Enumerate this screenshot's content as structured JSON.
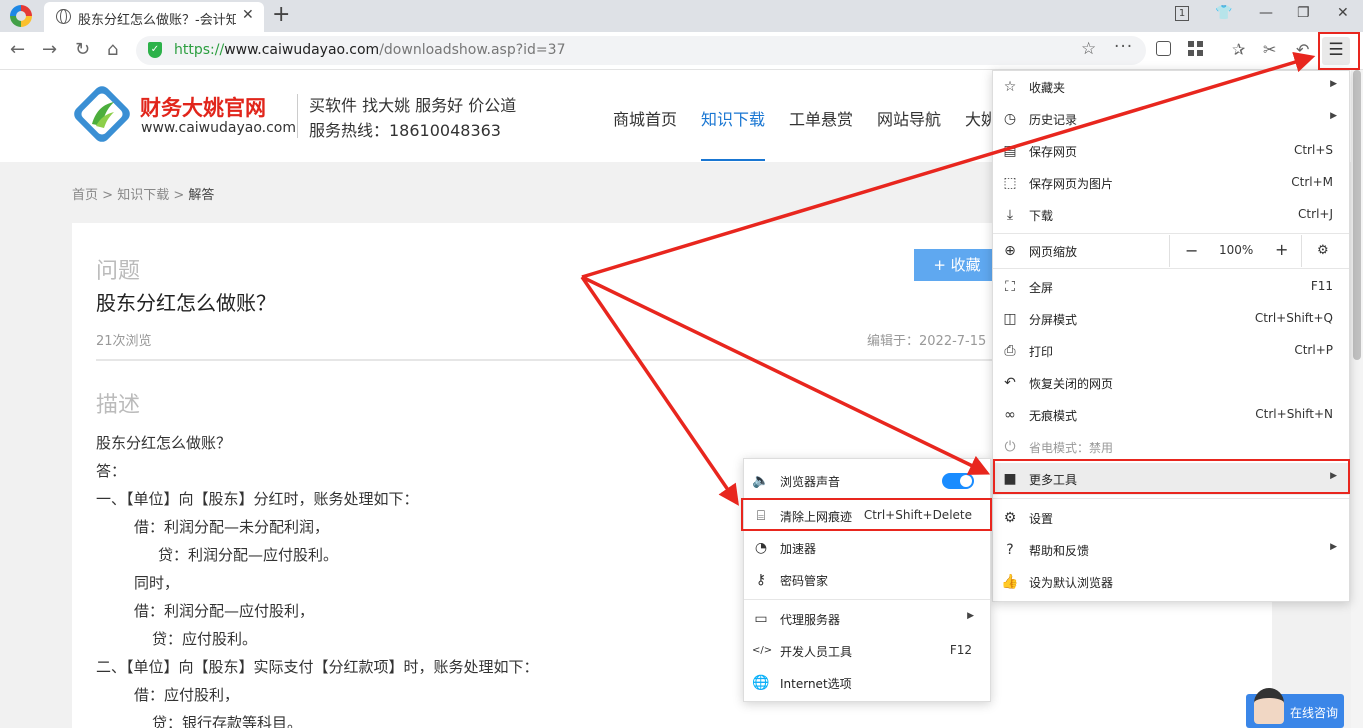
{
  "browser": {
    "tab_title": "股东分红怎么做账？-会计知识",
    "url_scheme": "https://",
    "url_host": "www.caiwudayao.com",
    "url_path": "/downloadshow.asp?id=37",
    "window_badge": "1"
  },
  "site": {
    "logo_name": "财务大姚官网",
    "logo_url": "www.caiwudayao.com",
    "slogan": "买软件  找大姚  服务好  价公道",
    "hotline": "服务热线：18610048363",
    "nav": [
      "商城首页",
      "知识下载",
      "工单悬赏",
      "网站导航",
      "大姚"
    ]
  },
  "breadcrumb": {
    "home": "首页",
    "sep": ">",
    "section": "知识下载",
    "current": "解答"
  },
  "article": {
    "question_label": "问题",
    "title": "股东分红怎么做账？",
    "favorite_label": "+ 收藏",
    "views": "21次浏览",
    "edited": "编辑于：2022-7-15",
    "desc_label": "描述",
    "lines": [
      "股东分红怎么做账？",
      "答：",
      "一、【单位】向【股东】分红时，账务处理如下：",
      "借：利润分配—未分配利润，",
      "贷：利润分配—应付股利。",
      "同时，",
      "借：利润分配—应付股利，",
      "贷：应付股利。",
      "二、【单位】向【股东】实际支付【分红款项】时，账务处理如下：",
      "借：应付股利，",
      "贷：银行存款等科目。"
    ]
  },
  "menu": {
    "items": [
      {
        "label": "收藏夹",
        "shortcut": "",
        "icon": "favorites-icon"
      },
      {
        "label": "历史记录",
        "shortcut": "",
        "icon": "history-icon"
      },
      {
        "label": "保存网页",
        "shortcut": "Ctrl+S",
        "icon": "save-page-icon"
      },
      {
        "label": "保存网页为图片",
        "shortcut": "Ctrl+M",
        "icon": "save-image-icon"
      },
      {
        "label": "下载",
        "shortcut": "Ctrl+J",
        "icon": "download-icon"
      },
      {
        "label": "网页缩放",
        "shortcut": "",
        "icon": "zoom-icon"
      },
      {
        "label": "全屏",
        "shortcut": "F11",
        "icon": "fullscreen-icon"
      },
      {
        "label": "分屏模式",
        "shortcut": "Ctrl+Shift+Q",
        "icon": "split-screen-icon"
      },
      {
        "label": "打印",
        "shortcut": "Ctrl+P",
        "icon": "print-icon"
      },
      {
        "label": "恢复关闭的网页",
        "shortcut": "",
        "icon": "restore-icon"
      },
      {
        "label": "无痕模式",
        "shortcut": "Ctrl+Shift+N",
        "icon": "incognito-icon"
      },
      {
        "label": "省电模式：禁用",
        "shortcut": "",
        "icon": "power-save-icon"
      },
      {
        "label": "更多工具",
        "shortcut": "",
        "icon": "toolbox-icon"
      },
      {
        "label": "设置",
        "shortcut": "",
        "icon": "gear-icon"
      },
      {
        "label": "帮助和反馈",
        "shortcut": "",
        "icon": "help-icon"
      },
      {
        "label": "设为默认浏览器",
        "shortcut": "",
        "icon": "thumbs-up-icon"
      }
    ],
    "zoom": {
      "minus": "−",
      "value": "100%",
      "plus": "+"
    }
  },
  "submenu": {
    "items": [
      {
        "label": "浏览器声音",
        "shortcut": "",
        "icon": "speaker-icon"
      },
      {
        "label": "清除上网痕迹",
        "shortcut": "Ctrl+Shift+Delete",
        "icon": "broom-icon"
      },
      {
        "label": "加速器",
        "shortcut": "",
        "icon": "speedometer-icon"
      },
      {
        "label": "密码管家",
        "shortcut": "",
        "icon": "key-icon"
      },
      {
        "label": "代理服务器",
        "shortcut": "",
        "icon": "proxy-icon"
      },
      {
        "label": "开发人员工具",
        "shortcut": "F12",
        "icon": "devtools-icon"
      },
      {
        "label": "Internet选项",
        "shortcut": "",
        "icon": "internet-options-icon"
      }
    ],
    "sound_enabled": true
  },
  "chat": {
    "label": "在线咨询"
  },
  "colors": {
    "accent": "#1976d2",
    "brand_red": "#e1251b",
    "annotation_red": "#e8261e",
    "secure_green": "#2db24a"
  }
}
